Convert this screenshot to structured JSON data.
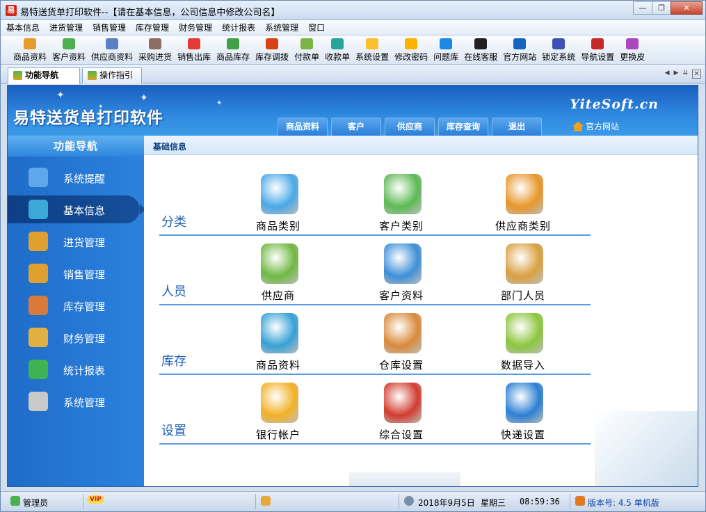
{
  "window": {
    "title": "易特送货单打印软件--【请在基本信息，公司信息中修改公司名】",
    "app_icon_glyph": "易",
    "minimize": "—",
    "restore": "❐",
    "close": "✕"
  },
  "menu": [
    "基本信息",
    "进货管理",
    "销售管理",
    "库存管理",
    "财务管理",
    "统计报表",
    "系统管理",
    "窗口"
  ],
  "toolbar": [
    {
      "label": "商品资料",
      "color": "#e89a2a"
    },
    {
      "label": "客户资料",
      "color": "#4caf50"
    },
    {
      "label": "供应商资料",
      "color": "#5b7fc7"
    },
    {
      "label": "采购进货",
      "color": "#8d6e63"
    },
    {
      "label": "销售出库",
      "color": "#e53935"
    },
    {
      "label": "商品库存",
      "color": "#43a047"
    },
    {
      "label": "库存调拨",
      "color": "#d84315"
    },
    {
      "label": "付款单",
      "color": "#7cb342"
    },
    {
      "label": "收款单",
      "color": "#26a69a"
    },
    {
      "label": "系统设置",
      "color": "#fbc02d"
    },
    {
      "label": "修改密码",
      "color": "#ffb300"
    },
    {
      "label": "问题库",
      "color": "#1e88e5"
    },
    {
      "label": "在线客服",
      "color": "#212121"
    },
    {
      "label": "官方网站",
      "color": "#1565c0"
    },
    {
      "label": "锁定系统",
      "color": "#3f51b5"
    },
    {
      "label": "导航设置",
      "color": "#c62828"
    },
    {
      "label": "更换皮",
      "color": "#ab47bc"
    }
  ],
  "tabs": [
    {
      "label": "功能导航",
      "active": true
    },
    {
      "label": "操作指引",
      "active": false
    }
  ],
  "tabnav": {
    "prev": "◀",
    "next": "▶",
    "menu": "⇊",
    "close": "✕"
  },
  "banner": {
    "brand": "易特送货单打印软件",
    "logo_en": "YiteSoft.cn",
    "site_link": "官方网站",
    "nav": [
      "商品资料",
      "客户",
      "供应商",
      "库存查询",
      "退出"
    ]
  },
  "sidebar": {
    "heading": "功能导航",
    "items": [
      {
        "label": "系统提醒",
        "icon": "info-icon",
        "color": "#5ea7e8"
      },
      {
        "label": "基本信息",
        "icon": "cubes-icon",
        "color": "#3aa8d8",
        "active": true
      },
      {
        "label": "进货管理",
        "icon": "box-in-icon",
        "color": "#e0a030"
      },
      {
        "label": "销售管理",
        "icon": "box-out-icon",
        "color": "#e0a030"
      },
      {
        "label": "库存管理",
        "icon": "house-icon",
        "color": "#d97a3a"
      },
      {
        "label": "财务管理",
        "icon": "money-icon",
        "color": "#e0b040"
      },
      {
        "label": "统计报表",
        "icon": "bar-chart-icon",
        "color": "#3fb34f"
      },
      {
        "label": "系统管理",
        "icon": "tools-icon",
        "color": "#c9c9c9"
      }
    ]
  },
  "main": {
    "breadcrumb": "基础信息",
    "sections": [
      {
        "label": "分类",
        "items": [
          {
            "label": "商品类别",
            "icon": "product-category-icon",
            "color": "#4aa8e8"
          },
          {
            "label": "客户类别",
            "icon": "customer-category-icon",
            "color": "#5db954"
          },
          {
            "label": "供应商类别",
            "icon": "supplier-category-icon",
            "color": "#e8962a"
          }
        ]
      },
      {
        "label": "人员",
        "items": [
          {
            "label": "供应商",
            "icon": "supplier-person-icon",
            "color": "#6fb842"
          },
          {
            "label": "客户资料",
            "icon": "customer-people-icon",
            "color": "#3e8fd8"
          },
          {
            "label": "部门人员",
            "icon": "staff-icon",
            "color": "#d9a040"
          }
        ]
      },
      {
        "label": "库存",
        "items": [
          {
            "label": "商品资料",
            "icon": "product-cubes-icon",
            "color": "#36a0d6"
          },
          {
            "label": "仓库设置",
            "icon": "warehouse-icon",
            "color": "#d98a3a"
          },
          {
            "label": "数据导入",
            "icon": "import-icon",
            "color": "#8cc63f"
          }
        ]
      },
      {
        "label": "设置",
        "items": [
          {
            "label": "银行帐户",
            "icon": "money-bag-icon",
            "color": "#f2b126"
          },
          {
            "label": "综合设置",
            "icon": "settings-tools-icon",
            "color": "#d23c2e"
          },
          {
            "label": "快递设置",
            "icon": "express-icon",
            "color": "#2a7fd3"
          }
        ]
      }
    ]
  },
  "statusbar": {
    "user": "管理员",
    "vip": "VIP",
    "date": "2018年9月5日",
    "weekday": "星期三",
    "time": "08:59:36",
    "version": "版本号: 4.5 单机版"
  }
}
